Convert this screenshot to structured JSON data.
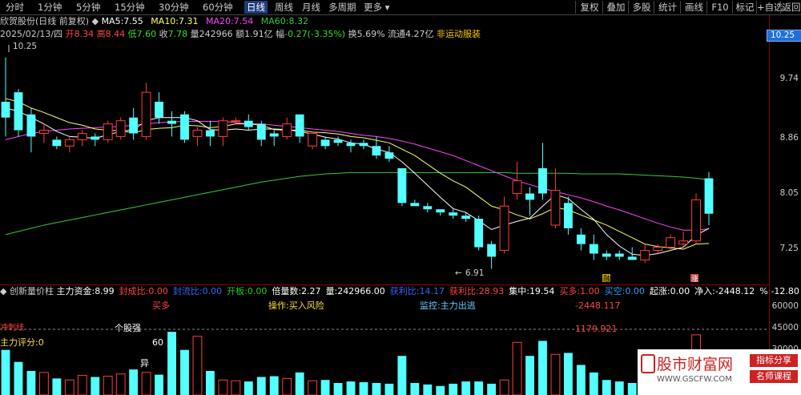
{
  "toolbar": {
    "periods": [
      "分时",
      "1分钟",
      "5分钟",
      "15分钟",
      "30分钟",
      "60分钟",
      "日线",
      "周线",
      "月线",
      "多周期",
      "更多"
    ],
    "right": [
      "复权",
      "叠加",
      "多股",
      "统计",
      "画线",
      "F10",
      "标记",
      "+自选",
      "返回"
    ]
  },
  "info": {
    "stock": "欣贺股份(日线 前复权)",
    "ma5_label": "MA5:",
    "ma5": "7.55",
    "ma10_label": "MA10:",
    "ma10": "7.31",
    "ma20_label": "MA20:",
    "ma20": "7.54",
    "ma60_label": "MA60:",
    "ma60": "8.32"
  },
  "quote": {
    "date": "2025/02/13/四",
    "open_label": "开",
    "open": "8.34",
    "high_label": "高",
    "high": "8.44",
    "low_label": "低",
    "low": "7.60",
    "close_label": "收",
    "close": "7.78",
    "vol_label": "量",
    "vol": "242966",
    "amt_label": "额",
    "amt": "1.91亿",
    "chg_label": "幅",
    "chg": "-0.27(-3.35%)",
    "turnover": "换5.69%",
    "float": "流通4.27亿",
    "concept": "非运动服装"
  },
  "price_axis": [
    "10.25",
    "9.74",
    "8.86",
    "8.05",
    "7.25"
  ],
  "current_price": "10.25",
  "annotations": {
    "high": "10.25",
    "low": "6.91"
  },
  "markers": {
    "rong": "融",
    "zhang": "涨"
  },
  "indicator": {
    "name": "创新量价柱",
    "items": [
      {
        "label": "主力资金:",
        "value": "8.99",
        "color": "#ffffff"
      },
      {
        "label": "封成比:",
        "value": "0.00",
        "color": "#ff4444"
      },
      {
        "label": "封流比:",
        "value": "0.00",
        "color": "#3366ff"
      },
      {
        "label": "开板:",
        "value": "0.00",
        "color": "#22cc22"
      },
      {
        "label": "倍量数:",
        "value": "2.27",
        "color": "#ffffff"
      },
      {
        "label": "量:",
        "value": "242966.00",
        "color": "#ffffff"
      },
      {
        "label": "获利比:",
        "value": "14.17",
        "color": "#3366ff"
      },
      {
        "label": "获利比:",
        "value": "28.93",
        "color": "#ff4444"
      },
      {
        "label": "集中:",
        "value": "19.54",
        "color": "#ffffff"
      },
      {
        "label": "买多:",
        "value": "1.00",
        "color": "#ff4444"
      },
      {
        "label": "买空:",
        "value": "0.00",
        "color": "#3399ff"
      },
      {
        "label": "起涨:",
        "value": "0.00",
        "color": "#ffffff"
      },
      {
        "label": "净入:",
        "value": "-2448.12",
        "color": "#ffffff"
      },
      {
        "label": "%:",
        "value": "-12.80",
        "color": "#ffffff"
      }
    ]
  },
  "signals": {
    "buy": "买多",
    "op": "操作:买入风险",
    "monitor": "监控:主力出逃",
    "jingru": "-2448.117",
    "val2": "1179.921",
    "zhuli_score": "主力评分:0",
    "gegu": "个股强",
    "score60": "60",
    "yi": "异",
    "label_left": "冲刺线"
  },
  "vol_axis": [
    "60000",
    "45000",
    "30000"
  ],
  "watermark": {
    "name": "股市财富网",
    "url": "WWW.GSCFW.COM",
    "tag1": "指标分享",
    "tag2": "名师课程"
  },
  "colors": {
    "up": "#ff3c3c",
    "down": "#54ffff",
    "ma5": "#ffffff",
    "ma10": "#ffff66",
    "ma20": "#ff44ff",
    "ma60": "#33cc33"
  },
  "chart_data": {
    "type": "candlestick",
    "ylim": [
      6.7,
      10.5
    ],
    "candles": [
      {
        "o": 9.55,
        "h": 10.25,
        "l": 9.0,
        "c": 9.3
      },
      {
        "o": 9.7,
        "h": 9.75,
        "l": 9.0,
        "c": 9.1
      },
      {
        "o": 9.35,
        "h": 9.45,
        "l": 8.75,
        "c": 9.0
      },
      {
        "o": 9.05,
        "h": 9.2,
        "l": 8.9,
        "c": 9.1
      },
      {
        "o": 8.95,
        "h": 9.0,
        "l": 8.8,
        "c": 8.85
      },
      {
        "o": 8.85,
        "h": 9.0,
        "l": 8.75,
        "c": 8.95
      },
      {
        "o": 8.95,
        "h": 9.1,
        "l": 8.85,
        "c": 9.05
      },
      {
        "o": 9.0,
        "h": 9.05,
        "l": 8.85,
        "c": 8.95
      },
      {
        "o": 8.95,
        "h": 9.25,
        "l": 8.9,
        "c": 9.2
      },
      {
        "o": 9.0,
        "h": 9.3,
        "l": 8.95,
        "c": 9.25
      },
      {
        "o": 9.3,
        "h": 9.45,
        "l": 8.95,
        "c": 9.05
      },
      {
        "o": 9.0,
        "h": 9.85,
        "l": 8.95,
        "c": 9.7
      },
      {
        "o": 9.55,
        "h": 9.7,
        "l": 9.2,
        "c": 9.3
      },
      {
        "o": 9.25,
        "h": 9.4,
        "l": 9.0,
        "c": 9.2
      },
      {
        "o": 9.35,
        "h": 9.4,
        "l": 8.9,
        "c": 8.95
      },
      {
        "o": 9.0,
        "h": 9.15,
        "l": 8.85,
        "c": 9.1
      },
      {
        "o": 9.1,
        "h": 9.25,
        "l": 8.85,
        "c": 9.0
      },
      {
        "o": 9.0,
        "h": 9.3,
        "l": 8.85,
        "c": 9.25
      },
      {
        "o": 9.25,
        "h": 9.3,
        "l": 9.2,
        "c": 9.25
      },
      {
        "o": 9.25,
        "h": 9.35,
        "l": 9.1,
        "c": 9.15
      },
      {
        "o": 9.2,
        "h": 9.25,
        "l": 8.85,
        "c": 8.95
      },
      {
        "o": 9.05,
        "h": 9.1,
        "l": 8.85,
        "c": 9.0
      },
      {
        "o": 9.0,
        "h": 9.3,
        "l": 8.95,
        "c": 9.2
      },
      {
        "o": 9.35,
        "h": 9.35,
        "l": 8.9,
        "c": 9.0
      },
      {
        "o": 8.85,
        "h": 9.05,
        "l": 8.8,
        "c": 9.05
      },
      {
        "o": 8.95,
        "h": 9.0,
        "l": 8.8,
        "c": 8.85
      },
      {
        "o": 8.95,
        "h": 9.0,
        "l": 8.85,
        "c": 8.9
      },
      {
        "o": 8.9,
        "h": 8.95,
        "l": 8.75,
        "c": 8.85
      },
      {
        "o": 8.9,
        "h": 8.95,
        "l": 8.8,
        "c": 8.85
      },
      {
        "o": 8.85,
        "h": 9.0,
        "l": 8.65,
        "c": 8.7
      },
      {
        "o": 8.75,
        "h": 8.85,
        "l": 8.6,
        "c": 8.65
      },
      {
        "o": 8.5,
        "h": 8.5,
        "l": 7.9,
        "c": 7.95
      },
      {
        "o": 7.95,
        "h": 8.0,
        "l": 7.9,
        "c": 7.9
      },
      {
        "o": 7.9,
        "h": 7.95,
        "l": 7.8,
        "c": 7.85
      },
      {
        "o": 7.85,
        "h": 7.85,
        "l": 7.75,
        "c": 7.8
      },
      {
        "o": 7.8,
        "h": 7.85,
        "l": 7.7,
        "c": 7.75
      },
      {
        "o": 7.75,
        "h": 7.8,
        "l": 7.65,
        "c": 7.7
      },
      {
        "o": 7.7,
        "h": 7.75,
        "l": 7.2,
        "c": 7.25
      },
      {
        "o": 7.3,
        "h": 7.35,
        "l": 6.91,
        "c": 7.1
      },
      {
        "o": 7.2,
        "h": 8.05,
        "l": 7.15,
        "c": 7.9
      },
      {
        "o": 8.1,
        "h": 8.6,
        "l": 8.0,
        "c": 8.3
      },
      {
        "o": 8.1,
        "h": 8.2,
        "l": 7.75,
        "c": 8.0
      },
      {
        "o": 8.5,
        "h": 8.9,
        "l": 8.0,
        "c": 8.1
      },
      {
        "o": 7.6,
        "h": 8.5,
        "l": 7.55,
        "c": 8.15
      },
      {
        "o": 7.95,
        "h": 8.05,
        "l": 7.45,
        "c": 7.55
      },
      {
        "o": 7.45,
        "h": 7.55,
        "l": 7.2,
        "c": 7.3
      },
      {
        "o": 7.3,
        "h": 7.45,
        "l": 7.05,
        "c": 7.15
      },
      {
        "o": 7.15,
        "h": 7.2,
        "l": 7.05,
        "c": 7.1
      },
      {
        "o": 7.15,
        "h": 7.2,
        "l": 7.05,
        "c": 7.1
      },
      {
        "o": 7.1,
        "h": 7.25,
        "l": 7.05,
        "c": 7.05
      },
      {
        "o": 7.05,
        "h": 7.3,
        "l": 7.0,
        "c": 7.2
      },
      {
        "o": 7.2,
        "h": 7.3,
        "l": 7.15,
        "c": 7.25
      },
      {
        "o": 7.25,
        "h": 7.45,
        "l": 7.2,
        "c": 7.4
      },
      {
        "o": 7.3,
        "h": 7.5,
        "l": 7.25,
        "c": 7.35
      },
      {
        "o": 7.35,
        "h": 8.1,
        "l": 7.3,
        "c": 8.0
      },
      {
        "o": 8.34,
        "h": 8.44,
        "l": 7.6,
        "c": 7.78
      }
    ],
    "ma5": [
      9.45,
      9.4,
      9.3,
      9.2,
      9.08,
      9.0,
      8.99,
      8.97,
      9.03,
      9.08,
      9.11,
      9.25,
      9.3,
      9.3,
      9.3,
      9.25,
      9.11,
      9.1,
      9.12,
      9.1,
      9.12,
      9.12,
      9.11,
      9.08,
      9.04,
      8.99,
      8.96,
      8.9,
      8.88,
      8.8,
      8.75,
      8.6,
      8.42,
      8.23,
      8.04,
      7.86,
      7.8,
      7.67,
      7.53,
      7.6,
      7.66,
      7.71,
      7.9,
      8.08,
      8.02,
      7.85,
      7.69,
      7.45,
      7.27,
      7.14,
      7.12,
      7.15,
      7.2,
      7.25,
      7.44,
      7.55
    ],
    "ma10": [
      9.6,
      9.55,
      9.45,
      9.38,
      9.3,
      9.22,
      9.18,
      9.12,
      9.1,
      9.09,
      9.06,
      9.11,
      9.13,
      9.14,
      9.18,
      9.17,
      9.14,
      9.16,
      9.2,
      9.2,
      9.18,
      9.11,
      9.1,
      9.1,
      9.07,
      9.06,
      9.04,
      9.0,
      8.98,
      8.94,
      8.9,
      8.8,
      8.7,
      8.56,
      8.42,
      8.3,
      8.2,
      8.05,
      7.9,
      7.84,
      7.76,
      7.7,
      7.78,
      7.88,
      7.84,
      7.76,
      7.68,
      7.6,
      7.5,
      7.4,
      7.3,
      7.26,
      7.24,
      7.22,
      7.3,
      7.31
    ],
    "ma20": [
      8.95,
      9.0,
      9.05,
      9.08,
      9.1,
      9.12,
      9.13,
      9.14,
      9.15,
      9.16,
      9.18,
      9.2,
      9.22,
      9.23,
      9.24,
      9.24,
      9.24,
      9.24,
      9.22,
      9.2,
      9.2,
      9.18,
      9.16,
      9.14,
      9.12,
      9.1,
      9.08,
      9.05,
      9.02,
      9.0,
      8.97,
      8.93,
      8.88,
      8.82,
      8.76,
      8.7,
      8.62,
      8.54,
      8.46,
      8.38,
      8.3,
      8.24,
      8.18,
      8.13,
      8.08,
      8.03,
      7.97,
      7.9,
      7.84,
      7.77,
      7.7,
      7.63,
      7.57,
      7.52,
      7.52,
      7.54
    ],
    "ma60": [
      7.45,
      7.5,
      7.55,
      7.6,
      7.64,
      7.68,
      7.72,
      7.76,
      7.8,
      7.84,
      7.88,
      7.92,
      7.96,
      8.0,
      8.04,
      8.08,
      8.12,
      8.16,
      8.2,
      8.24,
      8.28,
      8.31,
      8.34,
      8.37,
      8.39,
      8.41,
      8.42,
      8.43,
      8.43,
      8.43,
      8.43,
      8.43,
      8.43,
      8.43,
      8.43,
      8.43,
      8.43,
      8.43,
      8.43,
      8.43,
      8.42,
      8.42,
      8.42,
      8.42,
      8.42,
      8.41,
      8.41,
      8.41,
      8.41,
      8.4,
      8.39,
      8.38,
      8.37,
      8.36,
      8.34,
      8.32
    ],
    "volume": {
      "ylim": [
        0,
        65000
      ],
      "values": [
        30000,
        22000,
        16000,
        15000,
        11000,
        10000,
        13000,
        12000,
        12500,
        14000,
        17000,
        15000,
        13500,
        42000,
        30000,
        39000,
        16000,
        10000,
        9500,
        9000,
        12000,
        12500,
        11000,
        15000,
        9500,
        10000,
        8000,
        9000,
        8500,
        8000,
        7500,
        26000,
        8000,
        7000,
        6000,
        7500,
        9000,
        9000,
        7500,
        10000,
        35000,
        26000,
        36000,
        27000,
        28000,
        20000,
        15000,
        10000,
        9000,
        8000,
        9000,
        13000,
        12000,
        11000,
        40000,
        24000
      ]
    }
  }
}
